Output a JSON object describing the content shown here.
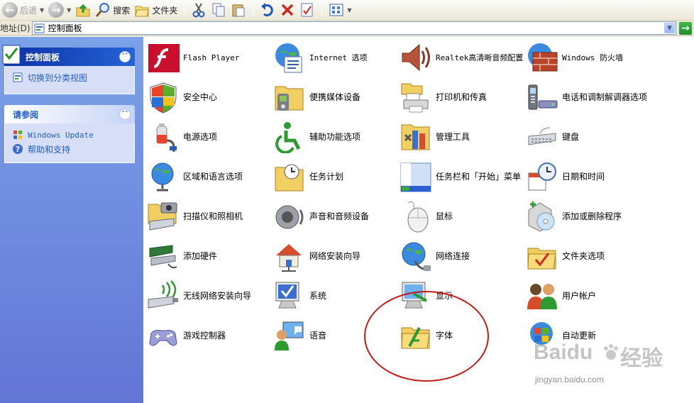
{
  "toolbar": {
    "back_label": "后退",
    "search_label": "搜索",
    "folders_label": "文件夹"
  },
  "address": {
    "label": "地址(D)",
    "value": "控制面板"
  },
  "sidebar": {
    "control_panel": {
      "title": "控制面板",
      "switch_view": "切换到分类视图"
    },
    "see_also": {
      "title": "请参阅",
      "windows_update": "Windows Update",
      "help": "帮助和支持"
    }
  },
  "items": [
    {
      "label": "Flash Player",
      "icon": "flash-icon"
    },
    {
      "label": "Internet 选项",
      "icon": "globe-doc-icon"
    },
    {
      "label": "Realtek高清晰音频配置",
      "icon": "speaker-icon"
    },
    {
      "label": "Windows 防火墙",
      "icon": "firewall-icon"
    },
    {
      "label": "安全中心",
      "icon": "shield-icon"
    },
    {
      "label": "便携媒体设备",
      "icon": "media-device-icon"
    },
    {
      "label": "打印机和传真",
      "icon": "printer-icon"
    },
    {
      "label": "电话和调制解调器选项",
      "icon": "phone-modem-icon"
    },
    {
      "label": "电源选项",
      "icon": "power-icon"
    },
    {
      "label": "辅助功能选项",
      "icon": "accessibility-icon"
    },
    {
      "label": "管理工具",
      "icon": "admin-tools-icon"
    },
    {
      "label": "键盘",
      "icon": "keyboard-icon"
    },
    {
      "label": "区域和语言选项",
      "icon": "globe-stand-icon"
    },
    {
      "label": "任务计划",
      "icon": "task-folder-icon"
    },
    {
      "label": "任务栏和「开始」菜单",
      "icon": "taskbar-icon"
    },
    {
      "label": "日期和时间",
      "icon": "clock-calendar-icon"
    },
    {
      "label": "扫描仪和照相机",
      "icon": "scanner-camera-icon"
    },
    {
      "label": "声音和音频设备",
      "icon": "sound-icon"
    },
    {
      "label": "鼠标",
      "icon": "mouse-icon"
    },
    {
      "label": "添加或删除程序",
      "icon": "add-remove-icon"
    },
    {
      "label": "添加硬件",
      "icon": "hardware-icon"
    },
    {
      "label": "网络安装向导",
      "icon": "house-network-icon"
    },
    {
      "label": "网络连接",
      "icon": "network-globe-icon"
    },
    {
      "label": "文件夹选项",
      "icon": "folder-check-icon"
    },
    {
      "label": "无线网络安装向导",
      "icon": "wireless-icon"
    },
    {
      "label": "系统",
      "icon": "system-monitor-icon"
    },
    {
      "label": "显示",
      "icon": "display-icon"
    },
    {
      "label": "用户帐户",
      "icon": "users-icon"
    },
    {
      "label": "游戏控制器",
      "icon": "gamepad-icon"
    },
    {
      "label": "语音",
      "icon": "speech-icon"
    },
    {
      "label": "字体",
      "icon": "fonts-folder-icon"
    },
    {
      "label": "自动更新",
      "icon": "windows-update-icon"
    }
  ],
  "watermark": {
    "brand": "Baidu",
    "product": "经验",
    "url": "jingyan.baidu.com"
  }
}
